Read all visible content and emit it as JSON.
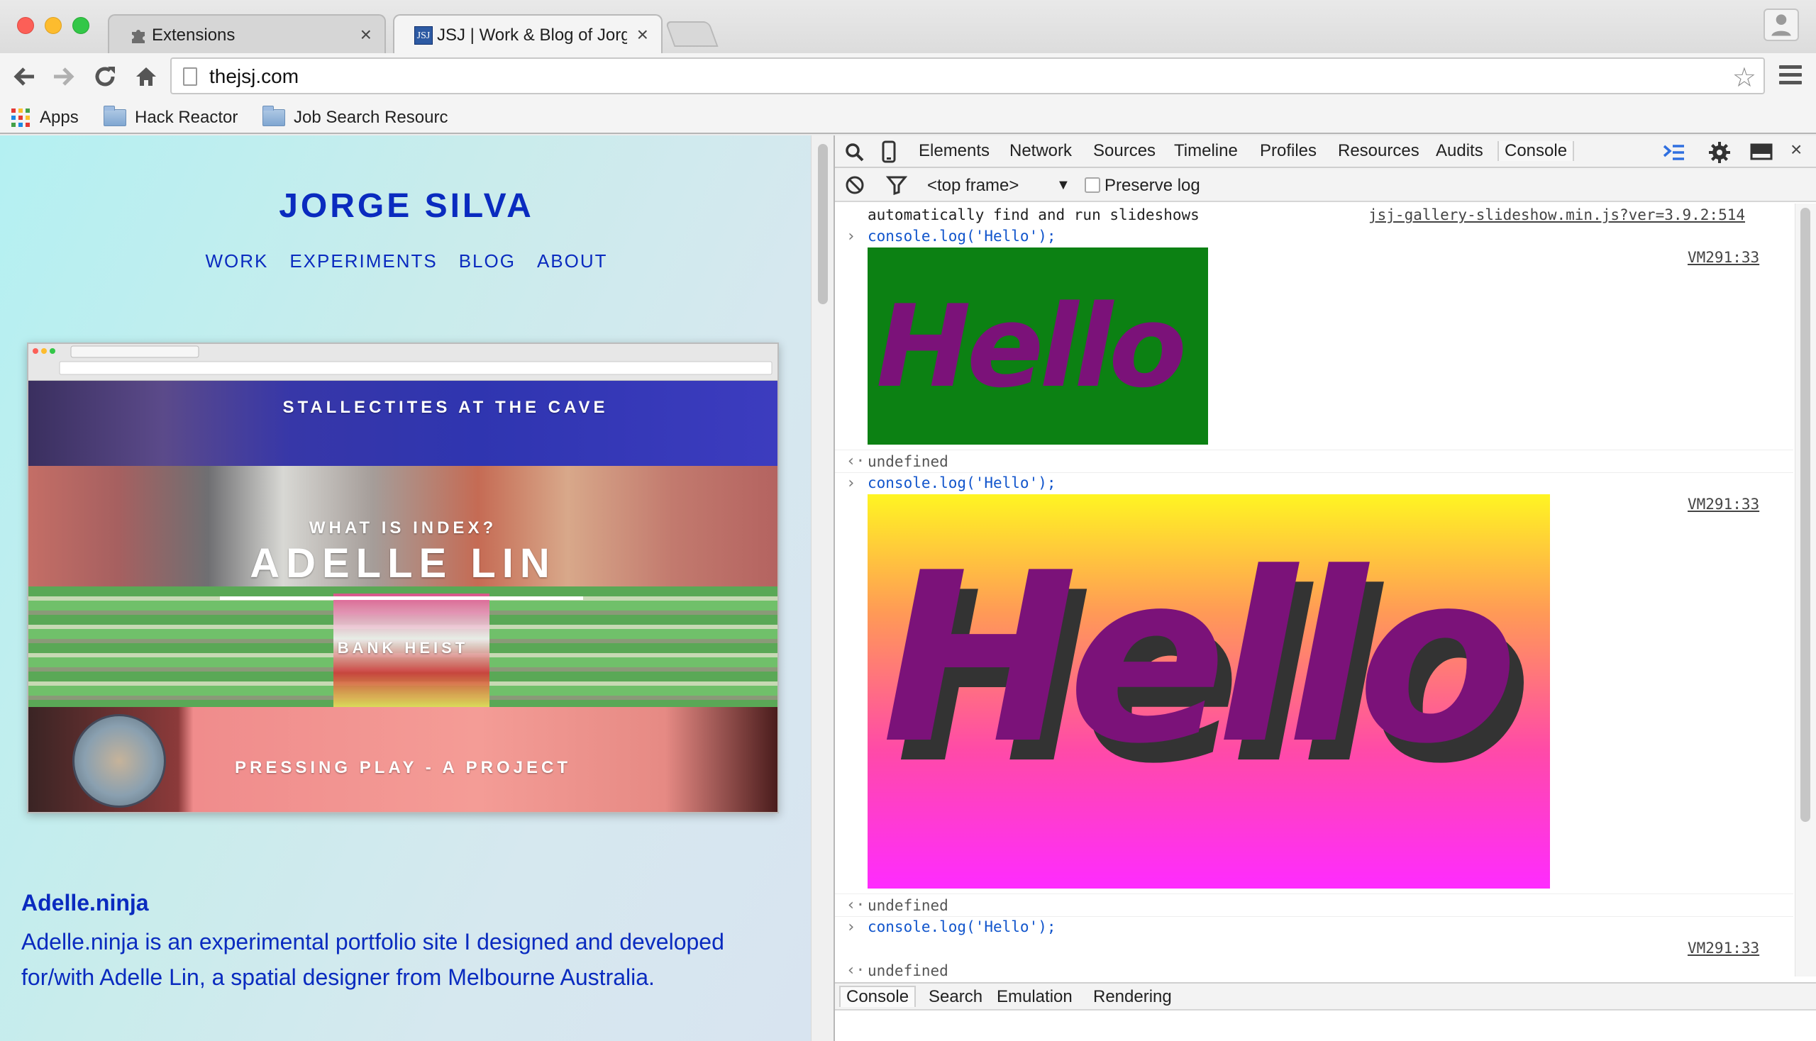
{
  "tabs": [
    {
      "title": "Extensions",
      "icon": "puzzle-icon"
    },
    {
      "title": "JSJ | Work & Blog of Jorge",
      "icon": "jsj-favicon",
      "icon_text": "JSJ"
    }
  ],
  "toolbar": {
    "url": "thejsj.com"
  },
  "bookmarks": [
    {
      "label": "Apps",
      "icon": "apps-grid-icon"
    },
    {
      "label": "Hack Reactor",
      "icon": "folder-icon"
    },
    {
      "label": "Job Search Resourc",
      "icon": "folder-icon"
    }
  ],
  "site": {
    "title": "JORGE SILVA",
    "nav": [
      "WORK",
      "EXPERIMENTS",
      "BLOG",
      "ABOUT"
    ],
    "screenshot_text": {
      "line1": "STALLECTITES AT THE CAVE",
      "line2": "WHAT IS INDEX?",
      "line3": "ADELLE LIN",
      "line4": "BANK HEIST",
      "line5": "PRESSING PLAY - A PROJECT"
    },
    "project_title": "Adelle.ninja",
    "project_desc": "Adelle.ninja is an experimental portfolio site I designed and developed for/with Adelle Lin, a spatial designer from Melbourne Australia."
  },
  "devtools": {
    "tabs": [
      "Elements",
      "Network",
      "Sources",
      "Timeline",
      "Profiles",
      "Resources",
      "Audits",
      "Console"
    ],
    "active_tab": "Console",
    "context": "<top frame>",
    "preserve_log": "Preserve log",
    "console": {
      "line0_text": "automatically find and run slideshows",
      "line0_src": "jsj-gallery-slideshow.min.js?ver=3.9.2:514",
      "cmd": "console.log('Hello');",
      "src": "VM291:33",
      "hello": "Hello",
      "result": "undefined"
    },
    "drawer_tabs": [
      "Console",
      "Search",
      "Emulation",
      "Rendering"
    ]
  },
  "colors": {
    "link_blue": "#0a2bbf",
    "hello_purple": "#7b1279",
    "hello_shadow": "#333333",
    "img1_bg": "#0c8113"
  }
}
